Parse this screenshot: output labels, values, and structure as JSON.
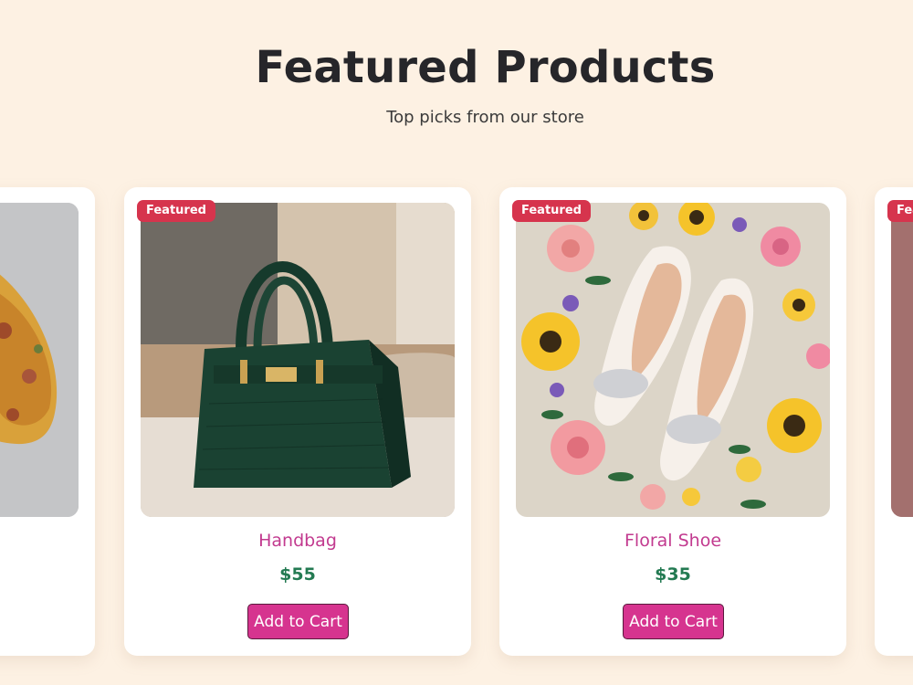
{
  "header": {
    "title": "Featured Products",
    "subtitle": "Top picks from our store"
  },
  "colors": {
    "background": "#fdf1e3",
    "badge": "#d6344d",
    "product_name": "#c23a8f",
    "price": "#237a52",
    "button": "#d6348f"
  },
  "products": [
    {
      "name": "",
      "price": "",
      "badge": "",
      "button_label": "",
      "image": "paisley-scarf-image"
    },
    {
      "name": "Handbag",
      "price": "$55",
      "badge": "Featured",
      "button_label": "Add to Cart",
      "image": "green-handbag-image"
    },
    {
      "name": "Floral Shoe",
      "price": "$35",
      "badge": "Featured",
      "button_label": "Add to Cart",
      "image": "white-shoes-flowers-image"
    },
    {
      "name": "",
      "price": "",
      "badge": "Featured",
      "button_label": "",
      "image": "pink-product-image"
    }
  ]
}
